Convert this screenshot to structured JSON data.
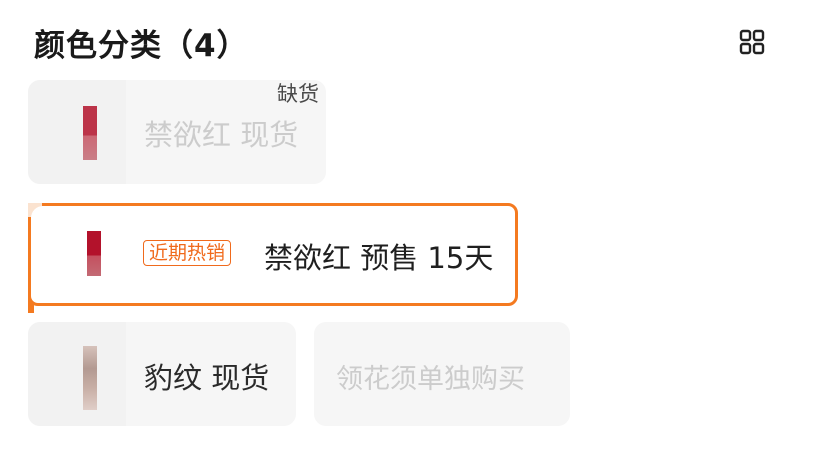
{
  "header": {
    "title": "颜色分类（4）",
    "view_toggle_icon": "grid-view-icon"
  },
  "stock_note": "缺货",
  "options": [
    {
      "label": "禁欲红 现货",
      "state": "sold-out",
      "swatch_color": "#b3122b"
    },
    {
      "tag": "近期热销",
      "label": "禁欲红 预售 15天",
      "state": "selected",
      "swatch_color": "#b3122b"
    },
    {
      "label": "豹纹 现货",
      "state": "available",
      "swatch_color": "#b39a92"
    },
    {
      "label": "领花须单独购买",
      "state": "disabled"
    }
  ],
  "colors": {
    "accent": "#f47a20",
    "tag": "#f06a1c",
    "disabled_text": "#cccccc"
  }
}
